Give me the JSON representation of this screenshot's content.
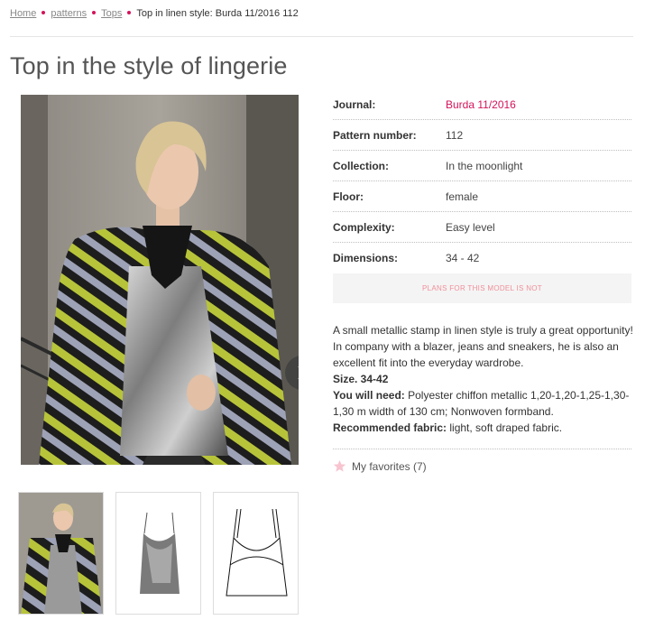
{
  "breadcrumb": {
    "home": "Home",
    "patterns": "patterns",
    "tops": "Tops",
    "current": "Top in linen style: Burda 11/2016 112"
  },
  "title": "Top in the style of lingerie",
  "details": [
    {
      "label": "Journal:",
      "value": "Burda 11/2016"
    },
    {
      "label": "Pattern number:",
      "value": "112"
    },
    {
      "label": "Collection:",
      "value": "In the moonlight"
    },
    {
      "label": "Floor:",
      "value": "female"
    },
    {
      "label": "Complexity:",
      "value": "Easy level"
    },
    {
      "label": "Dimensions:",
      "value": "34 - 42"
    }
  ],
  "plans_button": "PLANS FOR THIS MODEL IS NOT",
  "description": {
    "intro": "A small metallic stamp in linen style is truly a great opportunity! In company with a blazer, jeans and sneakers, he is also an excellent fit into the everyday wardrobe.",
    "size": "Size. 34-42",
    "need_label": "You will need:",
    "need_text": " Polyester chiffon metallic 1,20-1,20-1,25-1,30-1,30 m width of 130 cm; Nonwoven formband.",
    "fabric_label": "Recommended fabric:",
    "fabric_text": " light, soft draped fabric."
  },
  "favorites": "My favorites (7)",
  "colors": {
    "accent": "#d3135a",
    "plans_text": "#ef8f99",
    "star": "#f7c4d0"
  },
  "icons": {
    "next": "chevron-right-icon",
    "favorite": "star-icon"
  }
}
